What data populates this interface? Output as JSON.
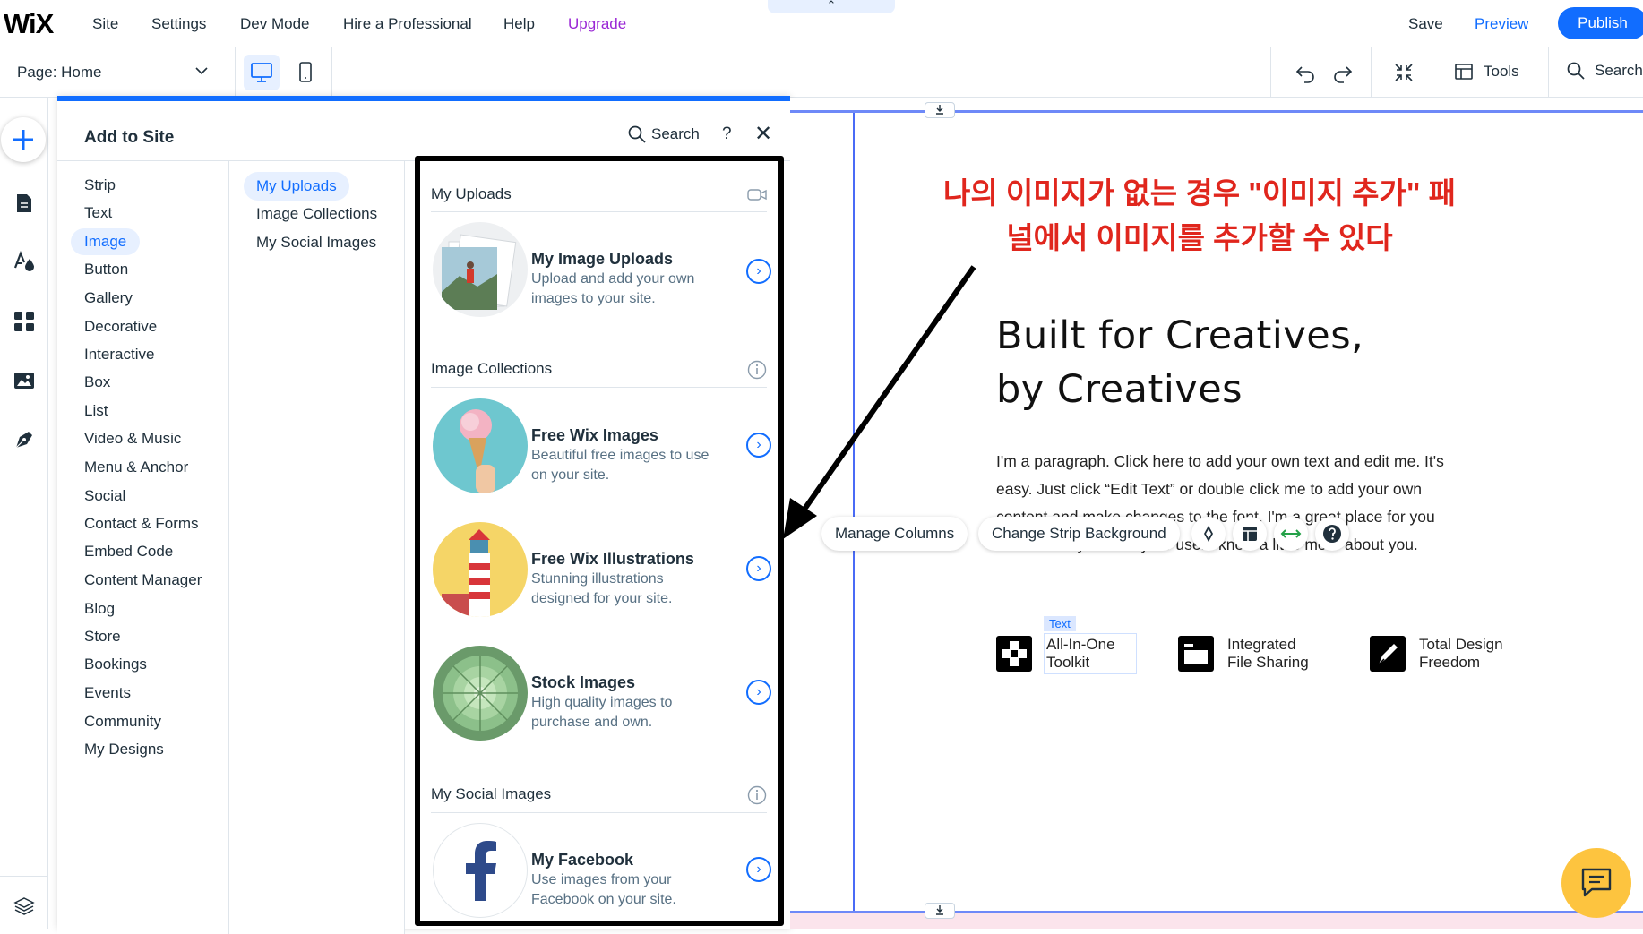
{
  "topbar": {
    "logo": "WiX",
    "menu": [
      "Site",
      "Settings",
      "Dev Mode",
      "Hire a Professional",
      "Help"
    ],
    "upgrade": "Upgrade",
    "collapse_glyph": "⌃",
    "save": "Save",
    "preview": "Preview",
    "publish": "Publish"
  },
  "secondbar": {
    "page_label": "Page: Home",
    "tools_label": "Tools",
    "search_label": "Search"
  },
  "panel": {
    "title": "Add to Site",
    "search": "Search",
    "help": "?",
    "close": "✕",
    "categories": [
      "Strip",
      "Text",
      "Image",
      "Button",
      "Gallery",
      "Decorative",
      "Interactive",
      "Box",
      "List",
      "Video & Music",
      "Menu & Anchor",
      "Social",
      "Contact & Forms",
      "Embed Code",
      "Content Manager",
      "Blog",
      "Store",
      "Bookings",
      "Events",
      "Community",
      "My Designs"
    ],
    "active_category": "Image",
    "subcategories": [
      "My Uploads",
      "Image Collections",
      "My Social Images"
    ],
    "active_subcategory": "My Uploads",
    "sections": {
      "uploads": {
        "title": "My Uploads",
        "card": {
          "title": "My Image Uploads",
          "desc": "Upload and add your own images to your site."
        }
      },
      "collections": {
        "title": "Image Collections",
        "cards": [
          {
            "title": "Free Wix Images",
            "desc": "Beautiful free images to use on your site."
          },
          {
            "title": "Free Wix Illustrations",
            "desc": "Stunning illustrations designed for your site."
          },
          {
            "title": "Stock Images",
            "desc": "High quality images to purchase and own."
          }
        ]
      },
      "social": {
        "title": "My Social Images",
        "card": {
          "title": "My Facebook",
          "desc": "Use images from your Facebook on your site."
        }
      }
    }
  },
  "canvas": {
    "annotation": "나의 이미지가 없는 경우 \"이미지 추가\" 패널에서 이미지를 추가할 수 있다",
    "headline_line1": "Built for Creatives,",
    "headline_line2": "by Creatives",
    "paragraph": "I'm a paragraph. Click here to add your own text and edit me. It's easy. Just click “Edit Text” or double click me to add your own content and make changes to the font. I'm a great place for you to tell a story and let your users know a little more about you.",
    "manage_columns": "Manage Columns",
    "change_strip_bg": "Change Strip Background",
    "text_tag": "Text",
    "features": [
      {
        "line1": "All-In-One",
        "line2": "Toolkit"
      },
      {
        "line1": "Integrated",
        "line2": "File Sharing"
      },
      {
        "line1": "Total Design",
        "line2": "Freedom"
      }
    ]
  },
  "colors": {
    "accent": "#116dff",
    "upgrade": "#9a27d5",
    "annotation_red": "#e0261d",
    "chat_yellow": "#fdc43f"
  }
}
